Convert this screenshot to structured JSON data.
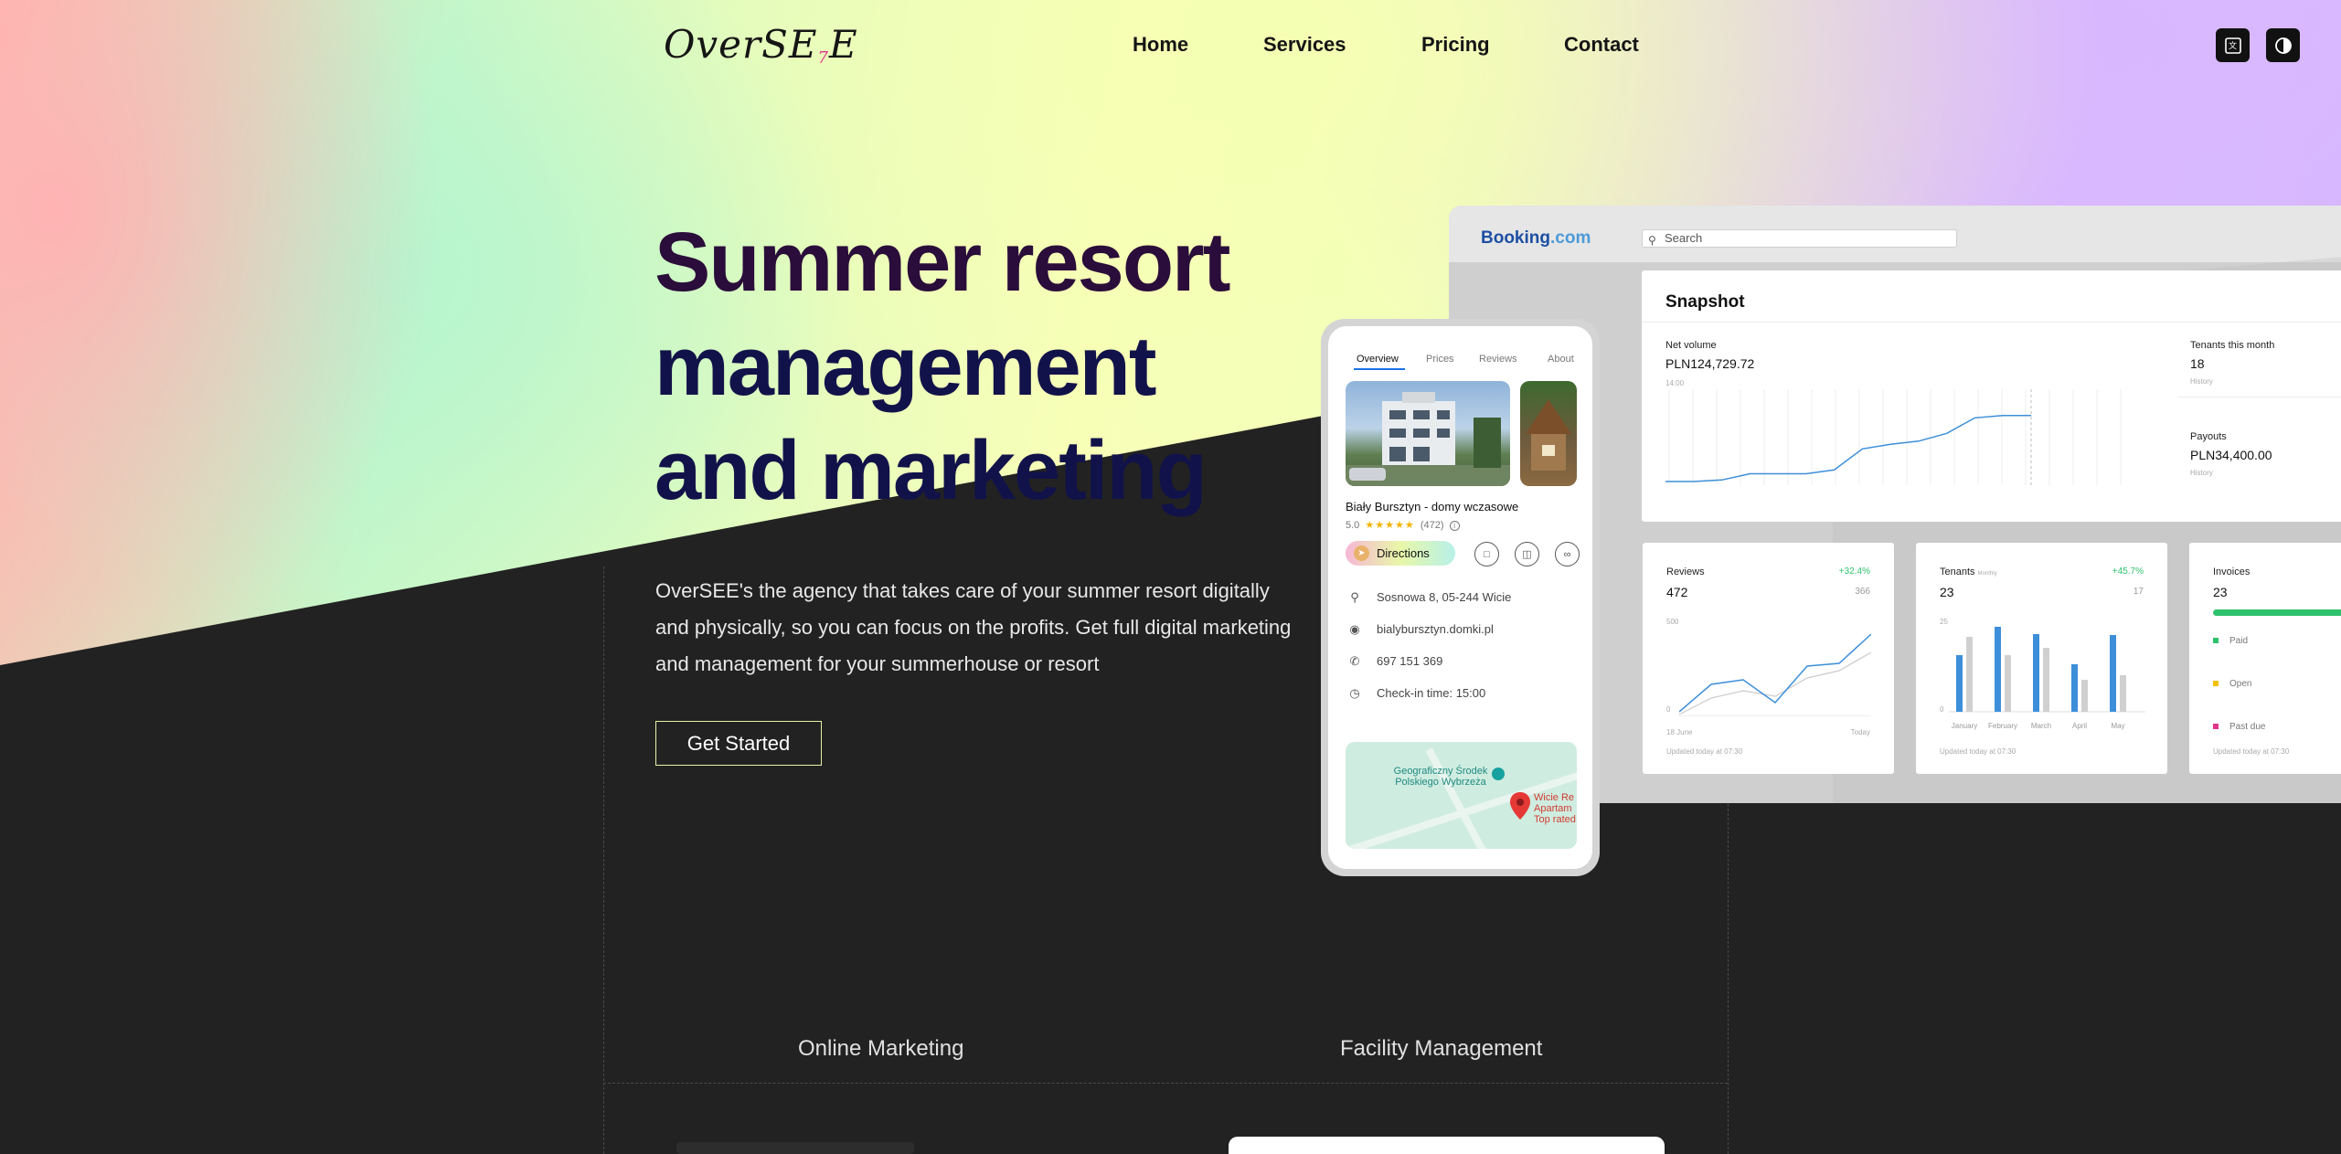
{
  "header": {
    "logo_text": "OverSE",
    "logo_accent": "7",
    "logo_tail": "E",
    "nav": [
      "Home",
      "Services",
      "Pricing",
      "Contact"
    ],
    "translate_icon": "translate-icon",
    "theme_icon": "contrast-icon"
  },
  "hero": {
    "title_line1": "Summer resort",
    "title_line2": "management",
    "title_line3": "and marketing",
    "description": "OverSEE's the agency that takes care of your summer resort digitally and physically, so you can focus on the profits. Get full digital marketing and management for your summerhouse or resort",
    "cta": "Get Started"
  },
  "sections": {
    "left": "Online Marketing",
    "right": "Facility Management"
  },
  "dashboard": {
    "brand": "Booking",
    "brand_suffix": ".com",
    "search_placeholder": "Search",
    "snapshot": {
      "title": "Snapshot",
      "net_volume_label": "Net volume",
      "net_volume_value": "PLN124,729.72",
      "time_label": "14:00",
      "tenants_label": "Tenants this month",
      "tenants_value": "18",
      "tenants_sub": "History",
      "payouts_label": "Payouts",
      "payouts_value": "PLN34,400.00",
      "payouts_sub": "History",
      "line_values": [
        0,
        0,
        0.02,
        0.1,
        0.1,
        0.1,
        0.15,
        0.42,
        0.48,
        0.52,
        0.62,
        0.82,
        0.85,
        0.85
      ]
    },
    "cards": {
      "reviews": {
        "title": "Reviews",
        "value": "472",
        "delta": "+32.4%",
        "previous": "366",
        "y_top": "500",
        "y_bottom": "0",
        "x_left": "18 June",
        "x_right": "Today",
        "footer": "Updated today at 07:30",
        "series_a": [
          0.05,
          0.35,
          0.4,
          0.15,
          0.55,
          0.58,
          0.9
        ],
        "series_b": [
          0.02,
          0.2,
          0.28,
          0.22,
          0.42,
          0.5,
          0.7
        ]
      },
      "tenants": {
        "title": "Tenants",
        "sub": "Monthly",
        "value": "23",
        "delta": "+45.7%",
        "previous": "17",
        "y_top": "25",
        "y_bottom": "0",
        "months": [
          "January",
          "February",
          "March",
          "April",
          "May"
        ],
        "bars_a": [
          0.62,
          0.93,
          0.85,
          0.52,
          0.84
        ],
        "bars_b": [
          0.82,
          0.62,
          0.7,
          0.35,
          0.4
        ],
        "footer": "Updated today at 07:30"
      },
      "invoices": {
        "title": "Invoices",
        "value": "23",
        "legend": [
          "Paid",
          "Open",
          "Past due"
        ],
        "legend_colors": [
          "#2ec26f",
          "#f3c000",
          "#e0348c"
        ],
        "footer": "Updated today at 07:30"
      }
    }
  },
  "phone": {
    "tabs": [
      "Overview",
      "Prices",
      "Reviews",
      "About"
    ],
    "place_name": "Biały Bursztyn - domy wczasowe",
    "rating": "5.0",
    "stars": "★★★★★",
    "reviews_count": "(472)",
    "directions": "Directions",
    "address": "Sosnowa 8, 05-244 Wicie",
    "website": "bialybursztyn.domki.pl",
    "phone": "697 151 369",
    "checkin": "Check-in time: 15:00",
    "map_label1": "Geograficzny Środek Polskiego Wybrzeża",
    "map_label2": "Wicie Re Apartam Top rated"
  },
  "colors": {
    "accent_logo": "#e0348c",
    "cta_border": "#e7f3a8",
    "dark_bg": "#222222",
    "chart_blue": "#3d8fd9"
  }
}
